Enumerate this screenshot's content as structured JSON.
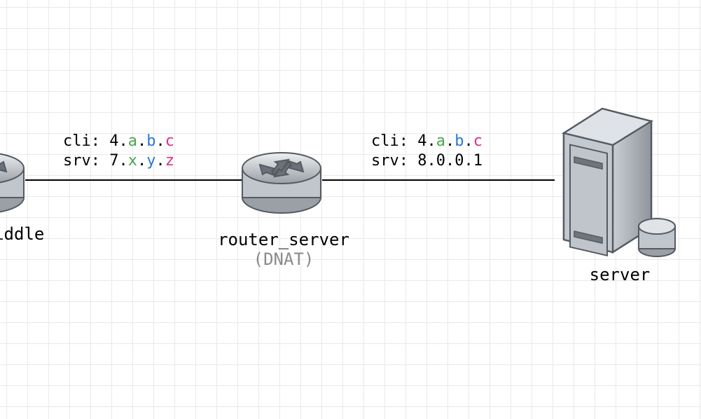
{
  "links": {
    "left": {
      "cli_prefix": "cli: ",
      "cli_base": "4",
      "cli_a": "a",
      "cli_b": "b",
      "cli_c": "c",
      "srv_prefix": "srv: ",
      "srv_base": "7",
      "srv_x": "x",
      "srv_y": "y",
      "srv_z": "z"
    },
    "right": {
      "cli_prefix": "cli: ",
      "cli_base": "4",
      "cli_a": "a",
      "cli_b": "b",
      "cli_c": "c",
      "srv_prefix": "srv: ",
      "srv_value": "8.0.0.1"
    }
  },
  "nodes": {
    "left_router_label": "middle",
    "mid_router_label": "router_server",
    "mid_router_sublabel": "(DNAT)",
    "server_label": "server"
  }
}
